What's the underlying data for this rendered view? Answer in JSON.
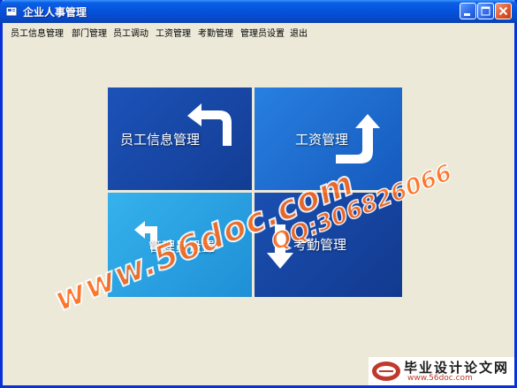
{
  "window": {
    "title": "企业人事管理",
    "icon": "app-icon"
  },
  "menu": [
    {
      "label": "员工信息管理"
    },
    {
      "label": "部门管理"
    },
    {
      "label": "员工调动"
    },
    {
      "label": "工资管理"
    },
    {
      "label": "考勤管理"
    },
    {
      "label": "管理员设置"
    },
    {
      "label": "退出"
    }
  ],
  "tiles": {
    "employee_info": {
      "label": "员工信息管理",
      "icon": "arrow-return-left-icon",
      "color": "#1646a5"
    },
    "salary": {
      "label": "工资管理",
      "icon": "arrow-up-right-icon",
      "color": "#1b6fd4"
    },
    "admin_settings": {
      "label": "管理员设置",
      "icon": "arrow-return-left-icon",
      "color": "#2aa1e0"
    },
    "attendance": {
      "label": "考勤管理",
      "icon": "arrow-down-icon",
      "color": "#163f9c"
    }
  },
  "watermark": {
    "site": "www.56doc.com",
    "qq": "QQ:306826066"
  },
  "footer_logo": {
    "title": "毕业设计论文网",
    "url": "www.56doc.com"
  },
  "colors": {
    "titlebar": "#0651da",
    "window_bg": "#ece9d8",
    "watermark": "#ff6a1a"
  }
}
